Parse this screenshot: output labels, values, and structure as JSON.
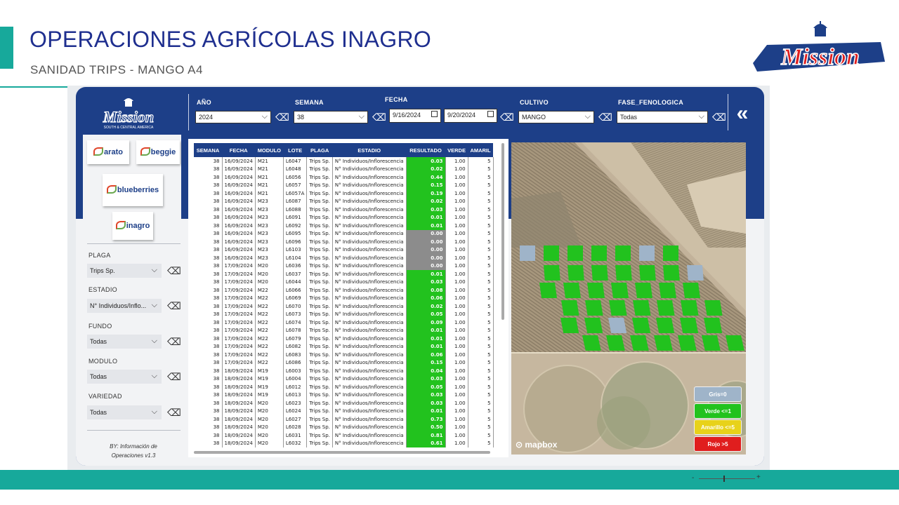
{
  "slide": {
    "title": "OPERACIONES AGRÍCOLAS INAGRO",
    "subtitle": "SANIDAD TRIPS - MANGO A4",
    "brand_logo_text": "Mission"
  },
  "colors": {
    "accent": "#17a99b",
    "navy": "#1d3f88",
    "title": "#1f2f8f",
    "green": "#22c21e",
    "gray": "#8c8c8c"
  },
  "zoom": {
    "minus": "-",
    "plus": "+"
  },
  "header": {
    "logo_text": "Mission",
    "logo_sub": "SOUTH & CENTRAL AMERICA",
    "filters": {
      "anio": {
        "label": "AÑO",
        "value": "2024"
      },
      "semana": {
        "label": "SEMANA",
        "value": "38"
      },
      "fecha": {
        "label": "FECHA",
        "from": "9/16/2024",
        "to": "9/20/2024"
      },
      "cultivo": {
        "label": "CULTIVO",
        "value": "MANGO"
      },
      "fase": {
        "label": "FASE_FENOLOGICA",
        "value": "Todas"
      }
    },
    "back_icon": "«"
  },
  "brands": {
    "arato": "arato",
    "beggie": "beggie",
    "blueberries": "blueberries",
    "inagro": "inagro"
  },
  "slicers": {
    "plaga": {
      "label": "PLAGA",
      "value": "Trips Sp."
    },
    "estado": {
      "label": "ESTADIO",
      "value": "N° Individuos/Inflo..."
    },
    "fundo": {
      "label": "FUNDO",
      "value": "Todas"
    },
    "modulo": {
      "label": "MODULO",
      "value": "Todas"
    },
    "variedad": {
      "label": "VARIEDAD",
      "value": "Todas"
    }
  },
  "footer_note": {
    "line1": "BY: Información de",
    "line2": "Operaciones v1.3"
  },
  "table": {
    "columns": [
      "SEMANA",
      "FECHA",
      "MODULO",
      "LOTE",
      "PLAGA",
      "ESTADIO",
      "RESULTADO",
      "VERDE",
      "AMARIL"
    ],
    "rows": [
      [
        "38",
        "16/09/2024",
        "M21",
        "L6047",
        "Trips Sp.",
        "N° Individuos/Inflorescencia",
        "0.03",
        "1.00",
        "5",
        "g"
      ],
      [
        "38",
        "16/09/2024",
        "M21",
        "L6048",
        "Trips Sp.",
        "N° Individuos/Inflorescencia",
        "0.02",
        "1.00",
        "5",
        "g"
      ],
      [
        "38",
        "16/09/2024",
        "M21",
        "L6056",
        "Trips Sp.",
        "N° Individuos/Inflorescencia",
        "0.44",
        "1.00",
        "5",
        "g"
      ],
      [
        "38",
        "16/09/2024",
        "M21",
        "L6057",
        "Trips Sp.",
        "N° Individuos/Inflorescencia",
        "0.15",
        "1.00",
        "5",
        "g"
      ],
      [
        "38",
        "16/09/2024",
        "M21",
        "L6057A",
        "Trips Sp.",
        "N° Individuos/Inflorescencia",
        "0.19",
        "1.00",
        "5",
        "g"
      ],
      [
        "38",
        "16/09/2024",
        "M23",
        "L6087",
        "Trips Sp.",
        "N° Individuos/Inflorescencia",
        "0.02",
        "1.00",
        "5",
        "g"
      ],
      [
        "38",
        "16/09/2024",
        "M23",
        "L6088",
        "Trips Sp.",
        "N° Individuos/Inflorescencia",
        "0.03",
        "1.00",
        "5",
        "g"
      ],
      [
        "38",
        "16/09/2024",
        "M23",
        "L6091",
        "Trips Sp.",
        "N° Individuos/Inflorescencia",
        "0.01",
        "1.00",
        "5",
        "g"
      ],
      [
        "38",
        "16/09/2024",
        "M23",
        "L6092",
        "Trips Sp.",
        "N° Individuos/Inflorescencia",
        "0.01",
        "1.00",
        "5",
        "g"
      ],
      [
        "38",
        "16/09/2024",
        "M23",
        "L6095",
        "Trips Sp.",
        "N° Individuos/Inflorescencia",
        "0.00",
        "1.00",
        "5",
        "x"
      ],
      [
        "38",
        "16/09/2024",
        "M23",
        "L6096",
        "Trips Sp.",
        "N° Individuos/Inflorescencia",
        "0.00",
        "1.00",
        "5",
        "x"
      ],
      [
        "38",
        "16/09/2024",
        "M23",
        "L6103",
        "Trips Sp.",
        "N° Individuos/Inflorescencia",
        "0.00",
        "1.00",
        "5",
        "x"
      ],
      [
        "38",
        "16/09/2024",
        "M23",
        "L6104",
        "Trips Sp.",
        "N° Individuos/Inflorescencia",
        "0.00",
        "1.00",
        "5",
        "x"
      ],
      [
        "38",
        "17/09/2024",
        "M20",
        "L6036",
        "Trips Sp.",
        "N° Individuos/Inflorescencia",
        "0.00",
        "1.00",
        "5",
        "x"
      ],
      [
        "38",
        "17/09/2024",
        "M20",
        "L6037",
        "Trips Sp.",
        "N° Individuos/Inflorescencia",
        "0.01",
        "1.00",
        "5",
        "g"
      ],
      [
        "38",
        "17/09/2024",
        "M20",
        "L6044",
        "Trips Sp.",
        "N° Individuos/Inflorescencia",
        "0.03",
        "1.00",
        "5",
        "g"
      ],
      [
        "38",
        "17/09/2024",
        "M22",
        "L6066",
        "Trips Sp.",
        "N° Individuos/Inflorescencia",
        "0.08",
        "1.00",
        "5",
        "g"
      ],
      [
        "38",
        "17/09/2024",
        "M22",
        "L6069",
        "Trips Sp.",
        "N° Individuos/Inflorescencia",
        "0.06",
        "1.00",
        "5",
        "g"
      ],
      [
        "38",
        "17/09/2024",
        "M22",
        "L6070",
        "Trips Sp.",
        "N° Individuos/Inflorescencia",
        "0.02",
        "1.00",
        "5",
        "g"
      ],
      [
        "38",
        "17/09/2024",
        "M22",
        "L6073",
        "Trips Sp.",
        "N° Individuos/Inflorescencia",
        "0.05",
        "1.00",
        "5",
        "g"
      ],
      [
        "38",
        "17/09/2024",
        "M22",
        "L6074",
        "Trips Sp.",
        "N° Individuos/Inflorescencia",
        "0.09",
        "1.00",
        "5",
        "g"
      ],
      [
        "38",
        "17/09/2024",
        "M22",
        "L6078",
        "Trips Sp.",
        "N° Individuos/Inflorescencia",
        "0.01",
        "1.00",
        "5",
        "g"
      ],
      [
        "38",
        "17/09/2024",
        "M22",
        "L6079",
        "Trips Sp.",
        "N° Individuos/Inflorescencia",
        "0.01",
        "1.00",
        "5",
        "g"
      ],
      [
        "38",
        "17/09/2024",
        "M22",
        "L6082",
        "Trips Sp.",
        "N° Individuos/Inflorescencia",
        "0.01",
        "1.00",
        "5",
        "g"
      ],
      [
        "38",
        "17/09/2024",
        "M22",
        "L6083",
        "Trips Sp.",
        "N° Individuos/Inflorescencia",
        "0.06",
        "1.00",
        "5",
        "g"
      ],
      [
        "38",
        "17/09/2024",
        "M22",
        "L6086",
        "Trips Sp.",
        "N° Individuos/Inflorescencia",
        "0.15",
        "1.00",
        "5",
        "g"
      ],
      [
        "38",
        "18/09/2024",
        "M19",
        "L6003",
        "Trips Sp.",
        "N° Individuos/Inflorescencia",
        "0.04",
        "1.00",
        "5",
        "g"
      ],
      [
        "38",
        "18/09/2024",
        "M19",
        "L6004",
        "Trips Sp.",
        "N° Individuos/Inflorescencia",
        "0.03",
        "1.00",
        "5",
        "g"
      ],
      [
        "38",
        "18/09/2024",
        "M19",
        "L6012",
        "Trips Sp.",
        "N° Individuos/Inflorescencia",
        "0.05",
        "1.00",
        "5",
        "g"
      ],
      [
        "38",
        "18/09/2024",
        "M19",
        "L6013",
        "Trips Sp.",
        "N° Individuos/Inflorescencia",
        "0.03",
        "1.00",
        "5",
        "g"
      ],
      [
        "38",
        "18/09/2024",
        "M20",
        "L6023",
        "Trips Sp.",
        "N° Individuos/Inflorescencia",
        "0.03",
        "1.00",
        "5",
        "g"
      ],
      [
        "38",
        "18/09/2024",
        "M20",
        "L6024",
        "Trips Sp.",
        "N° Individuos/Inflorescencia",
        "0.01",
        "1.00",
        "5",
        "g"
      ],
      [
        "38",
        "18/09/2024",
        "M20",
        "L6027",
        "Trips Sp.",
        "N° Individuos/Inflorescencia",
        "0.73",
        "1.00",
        "5",
        "g"
      ],
      [
        "38",
        "18/09/2024",
        "M20",
        "L6028",
        "Trips Sp.",
        "N° Individuos/Inflorescencia",
        "0.50",
        "1.00",
        "5",
        "g"
      ],
      [
        "38",
        "18/09/2024",
        "M20",
        "L6031",
        "Trips Sp.",
        "N° Individuos/Inflorescencia",
        "0.81",
        "1.00",
        "5",
        "g"
      ],
      [
        "38",
        "18/09/2024",
        "M20",
        "L6032",
        "Trips Sp.",
        "N° Individuos/Inflorescencia",
        "0.61",
        "1.00",
        "5",
        "g"
      ]
    ]
  },
  "map": {
    "attribution": "mapbox",
    "legend": [
      {
        "label": "Gris=0",
        "color": "#9fb4c9"
      },
      {
        "label": "Verde <=1",
        "color": "#22c21e"
      },
      {
        "label": "Amarillo <=5",
        "color": "#e8d21a"
      },
      {
        "label": "Rojo >5",
        "color": "#e01e1e"
      }
    ]
  }
}
